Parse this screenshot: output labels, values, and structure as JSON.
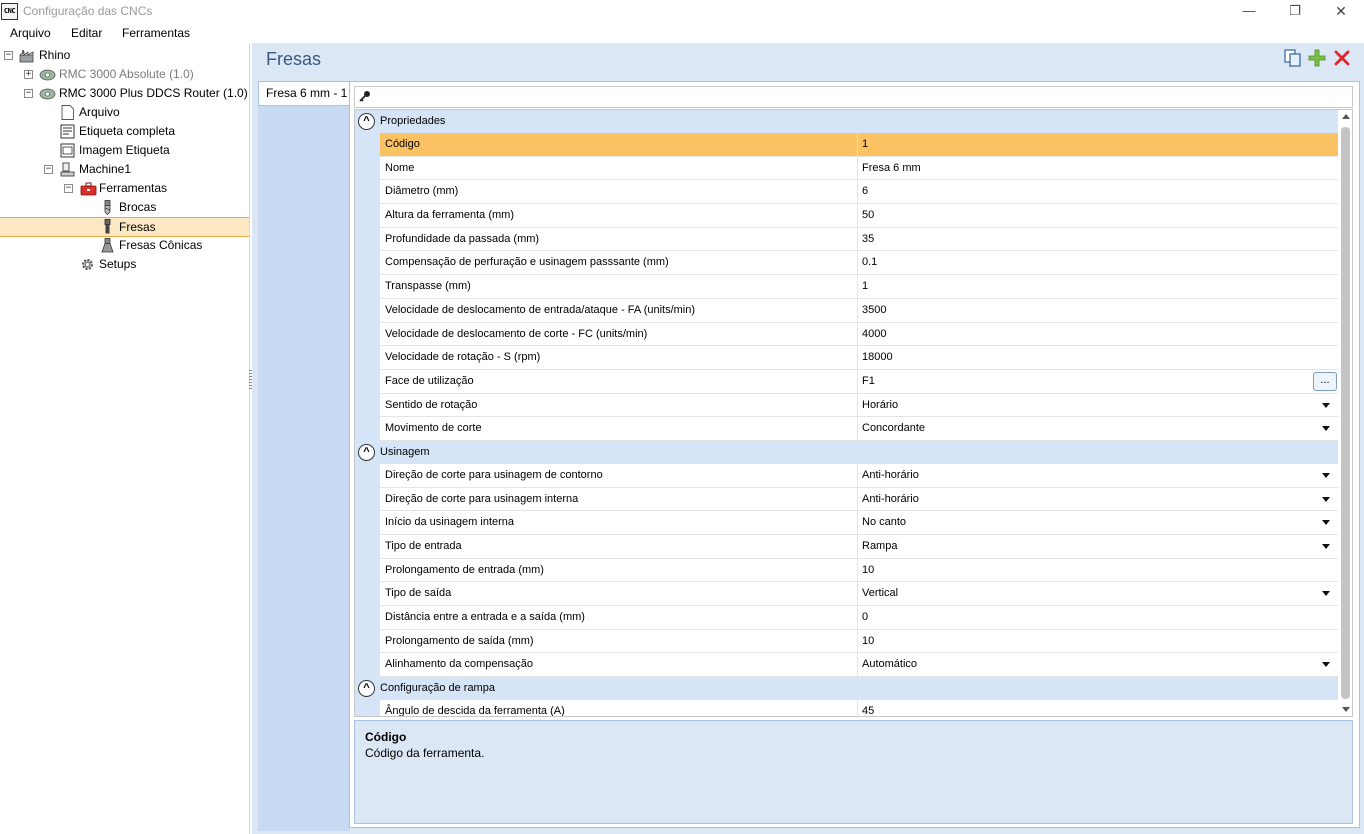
{
  "window": {
    "app_badge": "CNC",
    "title": "Configuração das CNCs",
    "min": "—",
    "max": "❐",
    "close": "✕"
  },
  "menu": [
    "Arquivo",
    "Editar",
    "Ferramentas"
  ],
  "tree": {
    "rhino": "Rhino",
    "rmc_abs": "RMC 3000 Absolute (1.0)",
    "rmc_plus": "RMC 3000 Plus DDCS Router (1.0)",
    "arquivo": "Arquivo",
    "etiqueta_completa": "Etiqueta completa",
    "imagem_etiqueta": "Imagem Etiqueta",
    "machine1": "Machine1",
    "ferramentas": "Ferramentas",
    "brocas": "Brocas",
    "fresas": "Fresas",
    "fresas_conicas": "Fresas Cônicas",
    "setups": "Setups"
  },
  "main": {
    "title": "Fresas",
    "tab_label": "Fresa 6 mm - 1",
    "categories": {
      "propriedades": "Propriedades",
      "usinagem": "Usinagem",
      "rampa": "Configuração de rampa"
    },
    "rows": [
      {
        "name": "Código",
        "value": "1"
      },
      {
        "name": "Nome",
        "value": "Fresa 6 mm"
      },
      {
        "name": "Diâmetro (mm)",
        "value": "6"
      },
      {
        "name": "Altura da ferramenta (mm)",
        "value": "50"
      },
      {
        "name": "Profundidade da passada (mm)",
        "value": "35"
      },
      {
        "name": "Compensação de perfuração e usinagem passsante (mm)",
        "value": "0.1"
      },
      {
        "name": "Transpasse (mm)",
        "value": "1"
      },
      {
        "name": "Velocidade de deslocamento de entrada/ataque - FA (units/min)",
        "value": "3500"
      },
      {
        "name": "Velocidade de deslocamento de corte - FC (units/min)",
        "value": "4000"
      },
      {
        "name": "Velocidade de rotação - S (rpm)",
        "value": "18000"
      },
      {
        "name": "Face de utilização",
        "value": "F1"
      },
      {
        "name": "Sentido de rotação",
        "value": "Horário"
      },
      {
        "name": "Movimento de corte",
        "value": "Concordante"
      },
      {
        "name": "Direção de corte para usinagem de contorno",
        "value": "Anti-horário"
      },
      {
        "name": "Direção de corte para usinagem interna",
        "value": "Anti-horário"
      },
      {
        "name": "Início da usinagem interna",
        "value": "No canto"
      },
      {
        "name": "Tipo de entrada",
        "value": "Rampa"
      },
      {
        "name": "Prolongamento de entrada (mm)",
        "value": "10"
      },
      {
        "name": "Tipo de saída",
        "value": "Vertical"
      },
      {
        "name": "Distância entre a entrada e a saída (mm)",
        "value": "0"
      },
      {
        "name": "Prolongamento de saída (mm)",
        "value": "10"
      },
      {
        "name": "Alinhamento da compensação",
        "value": "Automático"
      },
      {
        "name": "Ângulo de descida da ferramenta (A)",
        "value": "45"
      }
    ],
    "ellipsis_label": "...",
    "help": {
      "title": "Código",
      "description": "Código da ferramenta."
    }
  },
  "colors": {
    "selection": "#fbc263",
    "category_bg": "#d6e4f7",
    "panel_bg": "#dbe7f5",
    "delete_red": "#e0242c",
    "add_green": "#7ac143"
  }
}
